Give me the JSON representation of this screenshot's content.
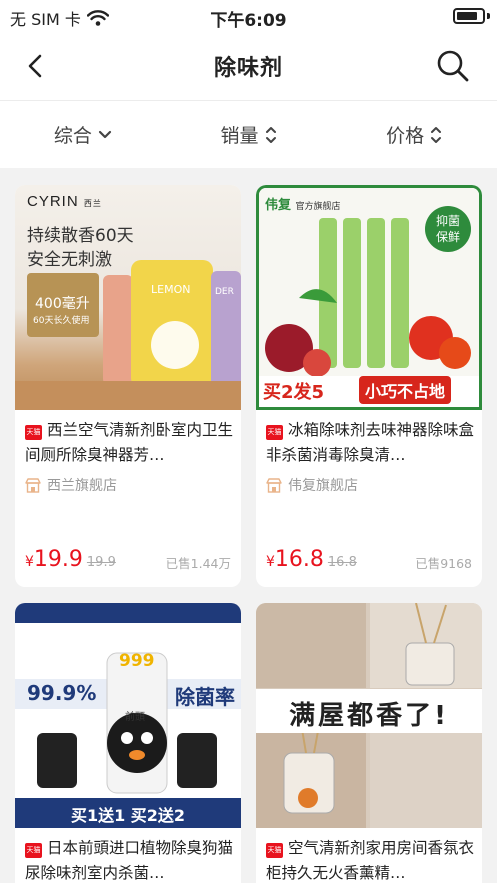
{
  "status_bar": {
    "carrier": "无 SIM 卡",
    "time": "下午6:09"
  },
  "nav": {
    "title": "除味剂"
  },
  "filters": [
    {
      "label": "综合"
    },
    {
      "label": "销量"
    },
    {
      "label": "价格"
    }
  ],
  "products": [
    {
      "badge": "天猫",
      "title": "西兰空气清新剂卧室内卫生间厕所除臭神器芳…",
      "shop": "西兰旗舰店",
      "price_symbol": "¥",
      "price": "19.9",
      "original_price": "19.9",
      "sold": "已售1.44万",
      "image_text": {
        "brand": "CYRIN",
        "brand_sub": "西兰",
        "line1": "持续散香60天",
        "line2": "安全无刺激",
        "box1": "400毫升",
        "box2": "60天长久使用",
        "jar": "LEMON",
        "jar2": "DER"
      }
    },
    {
      "badge": "天猫",
      "title": "冰箱除味剂去味神器除味盒非杀菌消毒除臭清…",
      "shop": "伟复旗舰店",
      "price_symbol": "¥",
      "price": "16.8",
      "original_price": "16.8",
      "sold": "已售9168",
      "image_text": {
        "brand": "伟复",
        "brand_sub": "官方旗舰店",
        "badge1": "抑菌",
        "badge2": "保鲜",
        "promo1": "买2发5",
        "promo2": "小巧不占地"
      }
    },
    {
      "badge": "天猫",
      "title": "日本前頭进口植物除臭狗猫尿除味剂室内杀菌…",
      "image_text": {
        "pct": "99.9%",
        "rate": "除菌率",
        "bottle": "999",
        "brand": "前頭",
        "promo": "买1送1 买2送2"
      }
    },
    {
      "badge": "天猫",
      "title": "空气清新剂家用房间香氛衣柜持久无火香薰精…",
      "image_text": {
        "headline": "满屋都香了!"
      }
    }
  ],
  "colors": {
    "price_red": "#e8131e",
    "tmall_red": "#e8131e",
    "brand_green": "#2e8b3c"
  }
}
